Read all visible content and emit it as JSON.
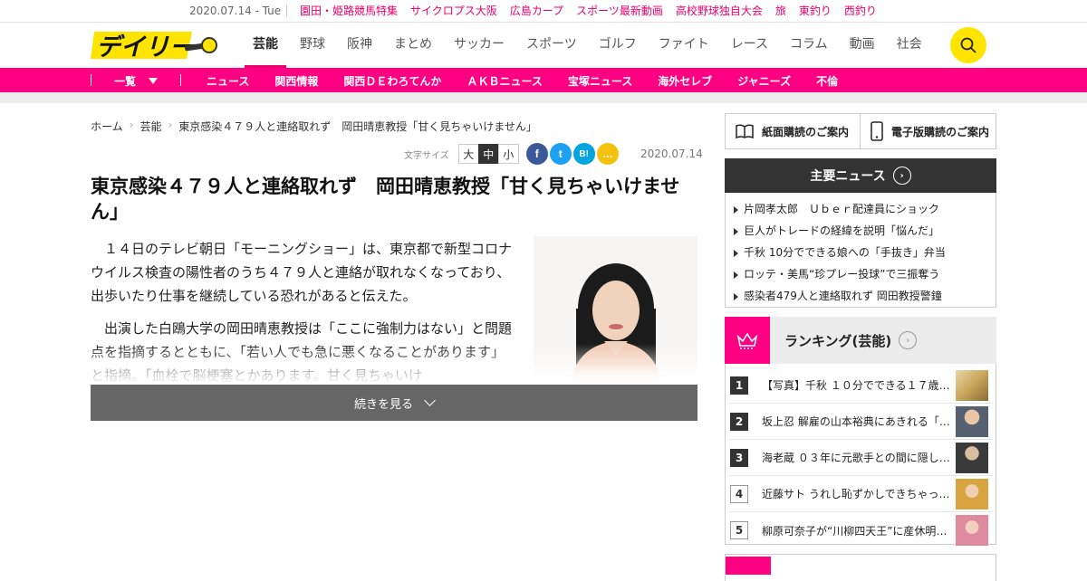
{
  "top_strip": {
    "date": "2020.07.14 - Tue",
    "links": [
      "園田・姫路競馬特集",
      "サイクロプス大阪",
      "広島カープ",
      "スポーツ最新動画",
      "高校野球独自大会",
      "旅",
      "東釣り",
      "西釣り"
    ]
  },
  "header": {
    "logo_text": "デイリー",
    "nav": [
      "芸能",
      "野球",
      "阪神",
      "まとめ",
      "サッカー",
      "スポーツ",
      "ゴルフ",
      "ファイト",
      "レース",
      "コラム",
      "動画",
      "社会"
    ],
    "active_nav": "芸能",
    "search_icon": "search-icon"
  },
  "subnav": {
    "all_label": "一覧",
    "items": [
      "ニュース",
      "関西情報",
      "関西ＤＥわろてんか",
      "ＡＫＢニュース",
      "宝塚ニュース",
      "海外セレブ",
      "ジャニーズ",
      "不倫"
    ]
  },
  "breadcrumb": [
    "ホーム",
    "芸能",
    "東京感染４７９人と連絡取れず　岡田晴恵教授「甘く見ちゃいけません」"
  ],
  "tools": {
    "font_size_label": "文字サイズ",
    "sizes": [
      "大",
      "中",
      "小"
    ],
    "selected_size": "中",
    "share": [
      {
        "name": "facebook-icon",
        "glyph": "f",
        "color": "#3b5998"
      },
      {
        "name": "twitter-icon",
        "glyph": "t",
        "color": "#1da1f2"
      },
      {
        "name": "hatena-icon",
        "glyph": "B!",
        "color": "#00a4de"
      },
      {
        "name": "line-icon",
        "glyph": "…",
        "color": "#f4c20d"
      }
    ]
  },
  "article": {
    "date": "2020.07.14",
    "title": "東京感染４７９人と連絡取れず　岡田晴恵教授「甘く見ちゃいけません」",
    "paragraphs": [
      "１４日のテレビ朝日「モーニングショー」は、東京都で新型コロナウイルス検査の陽性者のうち４７９人と連絡が取れなくなっており、出歩いたり仕事を継続している恐れがあると伝えた。",
      "出演した白鴎大学の岡田晴恵教授は「ここに強制力はない」と問題点を指摘するとともに、「若い人でも急に悪くなることがあります」と指摘。「血栓で脳梗塞とかあります。甘く見ちゃいけ"
    ],
    "more_label": "続きを見る"
  },
  "sidebar": {
    "subscribe_paper": "紙面購読のご案内",
    "subscribe_digital": "電子版購読のご案内",
    "main_news_title": "主要ニュース",
    "main_news": [
      "片岡孝太郎　Ｕｂｅｒ配達員にショック",
      "巨人がトレードの経緯を説明「悩んだ」",
      "千秋 10分でできる娘への「手抜き」弁当",
      "ロッテ・美馬“珍プレー投球”で三振奪う",
      "感染者479人と連絡取れず 岡田教授警鐘"
    ],
    "ranking_title": "ランキング(芸能)",
    "ranking": [
      {
        "no": "1",
        "text": "【写真】千秋 １０分でできる１７歳…",
        "thumb": "#c9a65a"
      },
      {
        "no": "2",
        "text": "坂上忍 解雇の山本裕典にあきれる「…",
        "thumb": "#556070"
      },
      {
        "no": "3",
        "text": "海老蔵 ０３年に元歌手との間に隠し…",
        "thumb": "#3a3a3a"
      },
      {
        "no": "4",
        "text": "近藤サト うれし恥ずかしできちゃっ…",
        "thumb": "#d8a440"
      },
      {
        "no": "5",
        "text": "柳原可奈子が“川柳四天王”に産休明け…",
        "thumb": "#e08aa0"
      }
    ]
  }
}
